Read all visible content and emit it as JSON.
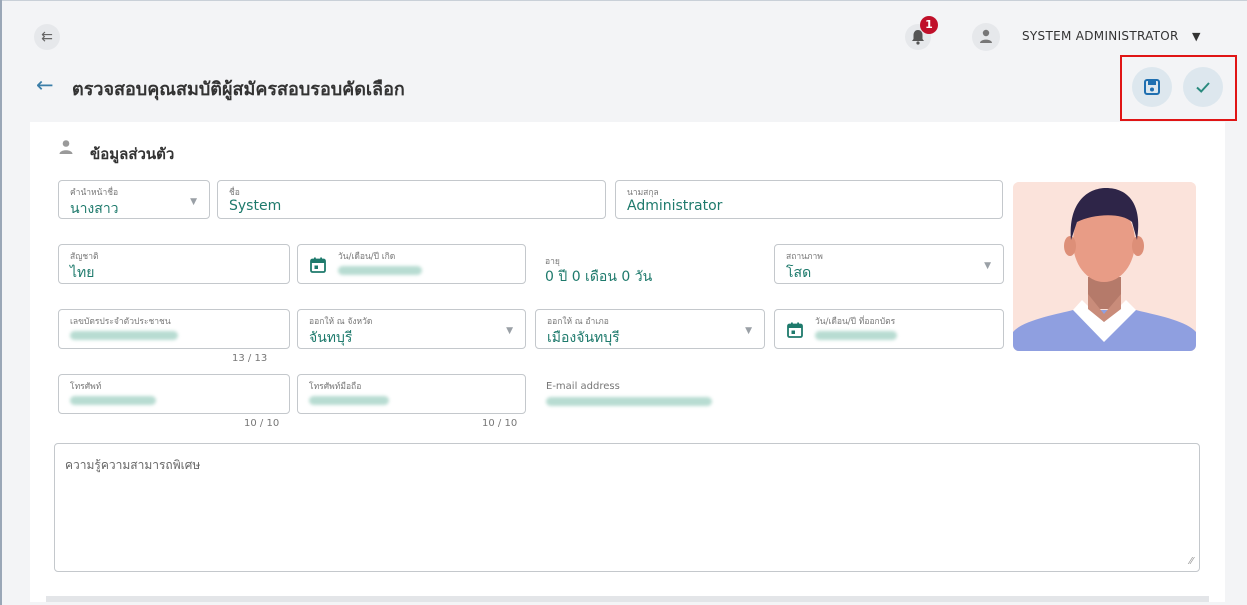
{
  "header": {
    "user_name": "SYSTEM ADMINISTRATOR",
    "notification_count": "1"
  },
  "page": {
    "title": "ตรวจสอบคุณสมบัติผู้สมัครสอบรอบคัดเลือก"
  },
  "section": {
    "title": "ข้อมูลส่วนตัว"
  },
  "form": {
    "prefix": {
      "label": "คำนำหน้าชื่อ",
      "value": "นางสาว"
    },
    "first_name": {
      "label": "ชื่อ",
      "value": "System"
    },
    "last_name": {
      "label": "นามสกุล",
      "value": "Administrator"
    },
    "nationality": {
      "label": "สัญชาติ",
      "value": "ไทย"
    },
    "birth_date": {
      "label": "วัน/เดือน/ปี เกิด"
    },
    "age": {
      "label": "อายุ",
      "value": "0 ปี 0 เดือน 0 วัน"
    },
    "marital_status": {
      "label": "สถานภาพ",
      "value": "โสด"
    },
    "id_card": {
      "label": "เลขบัตรประจำตัวประชาชน",
      "counter": "13 / 13"
    },
    "issue_province": {
      "label": "ออกให้ ณ จังหวัด",
      "value": "จันทบุรี"
    },
    "issue_district": {
      "label": "ออกให้ ณ อำเภอ",
      "value": "เมืองจันทบุรี"
    },
    "issue_date": {
      "label": "วัน/เดือน/ปี ที่ออกบัตร"
    },
    "phone": {
      "label": "โทรศัพท์",
      "counter": "10 / 10"
    },
    "mobile": {
      "label": "โทรศัพท์มือถือ",
      "counter": "10 / 10"
    },
    "email": {
      "label": "E-mail address"
    },
    "special_skills": {
      "placeholder": "ความรู้ความสามารถพิเศษ"
    }
  },
  "colors": {
    "accent": "#3b7ea8",
    "value_text": "#1e7a6c",
    "highlight_box": "#e01515",
    "badge": "#c0102a"
  },
  "icons": [
    "collapse-menu-icon",
    "bell-icon",
    "user-icon",
    "back-arrow-icon",
    "save-icon",
    "check-icon",
    "person-icon",
    "calendar-icon",
    "chevron-down-icon",
    "resize-grip-icon"
  ]
}
